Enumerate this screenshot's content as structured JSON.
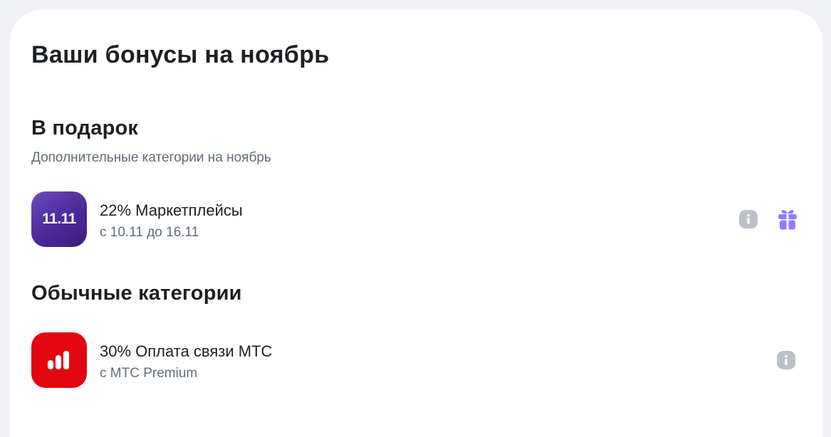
{
  "page": {
    "title": "Ваши бонусы на ноябрь"
  },
  "gift_section": {
    "title": "В подарок",
    "subtitle": "Дополнительные категории на ноябрь",
    "items": [
      {
        "tile_text": "11.11",
        "title": "22% Маркетплейсы",
        "subtitle": "с 10.11 до 16.11",
        "icons": [
          "info-icon",
          "gift-icon"
        ]
      }
    ]
  },
  "regular_section": {
    "title": "Обычные категории",
    "items": [
      {
        "tile_icon": "mts-logo-icon",
        "title": "30% Оплата связи МТС",
        "subtitle": "с МТС Premium",
        "icons": [
          "info-icon"
        ]
      }
    ]
  },
  "colors": {
    "background": "#f0f1f5",
    "card": "#ffffff",
    "text_primary": "#1d2023",
    "text_secondary": "#626c77",
    "tile_purple": "#4a2a96",
    "tile_red": "#e30611",
    "info_icon": "#bbc1c7",
    "gift_icon": "#8f7dff"
  }
}
